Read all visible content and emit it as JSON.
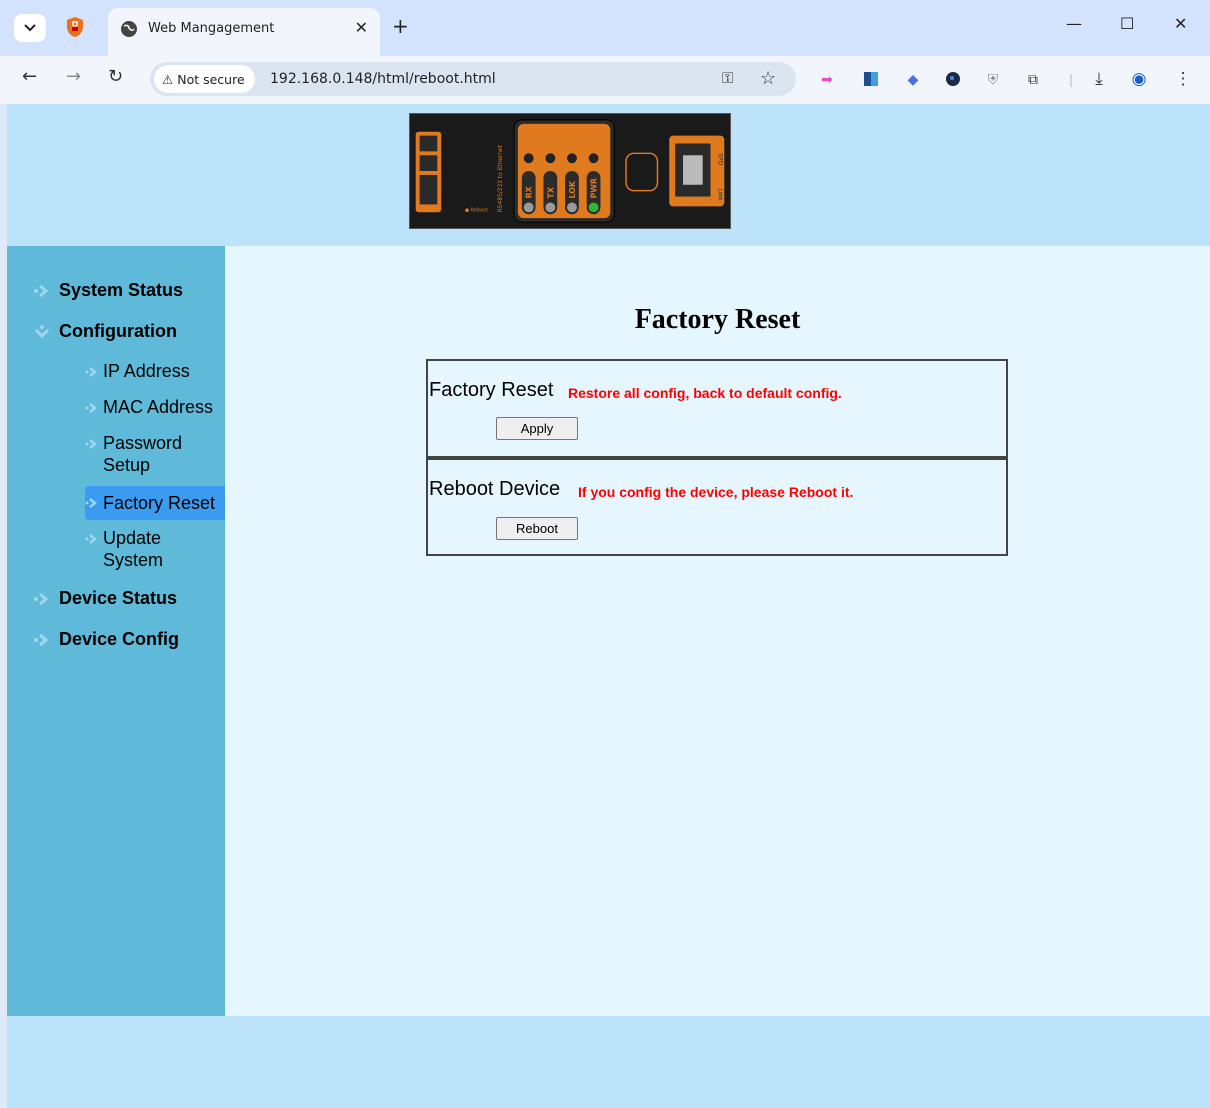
{
  "browser": {
    "tab_title": "Web Mangagement",
    "security_label": "Not secure",
    "url": "192.168.0.148/html/reboot.html"
  },
  "sidebar": {
    "items": [
      {
        "label": "System Status"
      },
      {
        "label": "Configuration",
        "children": [
          {
            "label": "IP Address"
          },
          {
            "label": "MAC Address"
          },
          {
            "label": "Password Setup"
          },
          {
            "label": "Factory Reset",
            "active": true
          },
          {
            "label": "Update System"
          }
        ]
      },
      {
        "label": "Device Status"
      },
      {
        "label": "Device Config"
      }
    ]
  },
  "main": {
    "title": "Factory Reset",
    "factory": {
      "label": "Factory Reset",
      "note": "Restore all config, back to default config.",
      "button": "Apply"
    },
    "reboot": {
      "label": "Reboot Device",
      "note": "If you config the device, please Reboot it.",
      "button": "Reboot"
    }
  },
  "device_image": {
    "side_text": "RS485/232 to Ethernet",
    "leds": [
      "RX",
      "TX",
      "LOK",
      "PWR"
    ],
    "reset_label": "Reboot",
    "port_labels": [
      "SPD",
      "Link"
    ]
  },
  "colors": {
    "banner_bg": "#bde3fa",
    "sidebar_bg": "#5fbad9",
    "content_bg": "#e6f6fe",
    "active_item": "#3b9bf0",
    "note_red": "#ff0000",
    "device_orange": "#e07a1f"
  }
}
